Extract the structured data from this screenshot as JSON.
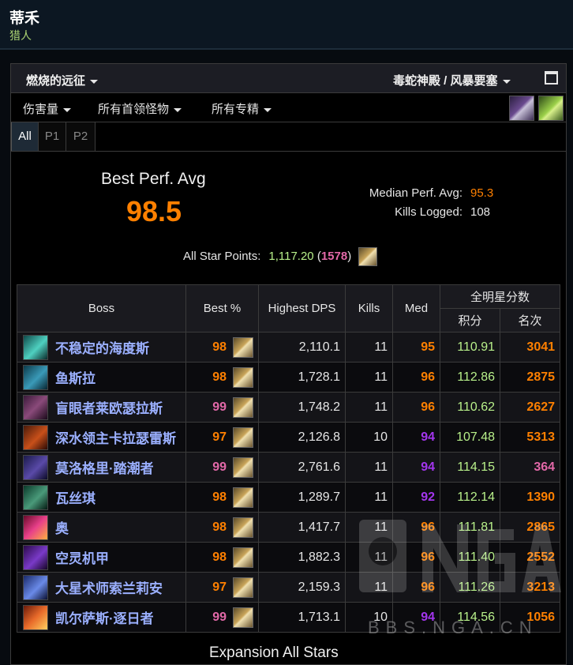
{
  "header": {
    "character_name": "蒂禾",
    "class_name": "猎人"
  },
  "topbar": {
    "expansion_label": "燃烧的远征",
    "raid_label": "毒蛇神殿 / 风暴要塞"
  },
  "filters": {
    "metric": "伤害量",
    "bosses": "所有首领怪物",
    "specs": "所有专精"
  },
  "tabs": [
    {
      "label": "All"
    },
    {
      "label": "P1"
    },
    {
      "label": "P2"
    }
  ],
  "stats": {
    "best_label": "Best Perf. Avg",
    "best_value": "98.5",
    "median_label": "Median Perf. Avg:",
    "median_value": "95.3",
    "kills_label": "Kills Logged:",
    "kills_value": "108",
    "star_label": "All Star Points:",
    "star_value": "1,117.20",
    "star_rank": "1578",
    "paren_open": "(",
    "paren_close": ")"
  },
  "table": {
    "headers": {
      "boss": "Boss",
      "best": "Best %",
      "dps": "Highest DPS",
      "kills": "Kills",
      "med": "Med",
      "allstar": "全明星分数",
      "points": "积分",
      "rank": "名次"
    },
    "rows": [
      {
        "name": "不稳定的海度斯",
        "best": "98",
        "dps": "2,110.1",
        "kills": "11",
        "med": "95",
        "points": "110.91",
        "rank": "3041"
      },
      {
        "name": "鱼斯拉",
        "best": "98",
        "dps": "1,728.1",
        "kills": "11",
        "med": "96",
        "points": "112.86",
        "rank": "2875"
      },
      {
        "name": "盲眼者莱欧瑟拉斯",
        "best": "99",
        "dps": "1,748.2",
        "kills": "11",
        "med": "96",
        "points": "110.62",
        "rank": "2627"
      },
      {
        "name": "深水领主卡拉瑟雷斯",
        "best": "97",
        "dps": "2,126.8",
        "kills": "10",
        "med": "94",
        "points": "107.48",
        "rank": "5313"
      },
      {
        "name": "莫洛格里·踏潮者",
        "best": "99",
        "dps": "2,761.6",
        "kills": "11",
        "med": "94",
        "points": "114.15",
        "rank": "364"
      },
      {
        "name": "瓦丝琪",
        "best": "98",
        "dps": "1,289.7",
        "kills": "11",
        "med": "92",
        "points": "112.14",
        "rank": "1390"
      },
      {
        "name": "奥",
        "best": "98",
        "dps": "1,417.7",
        "kills": "11",
        "med": "96",
        "points": "111.81",
        "rank": "2865"
      },
      {
        "name": "空灵机甲",
        "best": "98",
        "dps": "1,882.3",
        "kills": "11",
        "med": "96",
        "points": "111.40",
        "rank": "2552"
      },
      {
        "name": "大星术师索兰莉安",
        "best": "97",
        "dps": "2,159.3",
        "kills": "11",
        "med": "96",
        "points": "111.26",
        "rank": "3213"
      },
      {
        "name": "凯尔萨斯·逐日者",
        "best": "99",
        "dps": "1,713.1",
        "kills": "10",
        "med": "94",
        "points": "114.56",
        "rank": "1056"
      }
    ]
  },
  "colors": {
    "legendary": "#ff8000",
    "astounding": "#e268a8",
    "epic": "#a335ee",
    "boss_name": "#9bb0ff",
    "points": "#b8f08a",
    "hunter_class": "#abd473"
  },
  "icons": {
    "boss_portraits": [
      "hydross-icon",
      "lurker-icon",
      "leotheras-icon",
      "karathress-icon",
      "morogrim-icon",
      "vashj-icon",
      "alar-icon",
      "void-reaver-icon",
      "solarian-icon",
      "kaelthas-icon"
    ],
    "row_icon": "rank-icon",
    "spec_icons": [
      "beast-mastery-spec-icon",
      "marksmanship-spec-icon"
    ]
  },
  "watermark": {
    "text": "BBS.NGA.CN"
  },
  "footer": {
    "partial_title": "Expansion All Stars"
  }
}
